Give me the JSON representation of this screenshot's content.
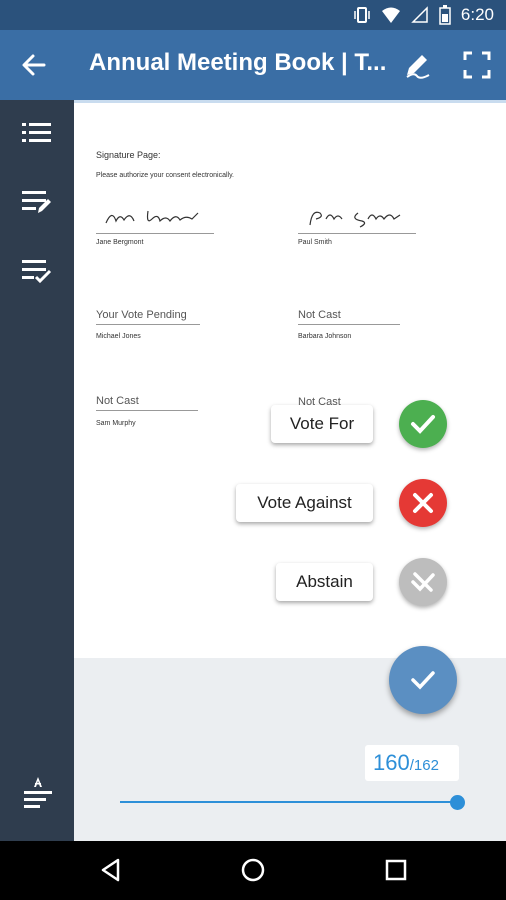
{
  "status_bar": {
    "time": "6:20"
  },
  "app_bar": {
    "title": "Annual Meeting Book | T..."
  },
  "document": {
    "heading": "Signature Page:",
    "subheading": "Please authorize your consent electronically.",
    "signers": [
      {
        "name": "Jane Bergmont",
        "signature": "Jane Bergmont"
      },
      {
        "name": "Paul Smith",
        "signature": "Paul Smith"
      }
    ],
    "vote_fields": [
      {
        "status": "Your Vote Pending",
        "name": "Michael Jones"
      },
      {
        "status": "Not Cast",
        "name": "Barbara Johnson"
      },
      {
        "status": "Not Cast",
        "name": "Sam Murphy"
      },
      {
        "status": "Not Cast",
        "name": ""
      }
    ]
  },
  "vote_actions": {
    "vote_for": "Vote For",
    "vote_against": "Vote Against",
    "abstain": "Abstain"
  },
  "pager": {
    "current": "160",
    "total": "/162",
    "progress": 0.99
  },
  "colors": {
    "app_bar": "#3a6ea5",
    "status_bar": "#2b527c",
    "sidebar": "#2f3d4e",
    "vote_for": "#4caf50",
    "vote_against": "#e53935",
    "abstain": "#bdbdbd",
    "fab": "#5b8fc2",
    "accent": "#2d8fd8"
  }
}
